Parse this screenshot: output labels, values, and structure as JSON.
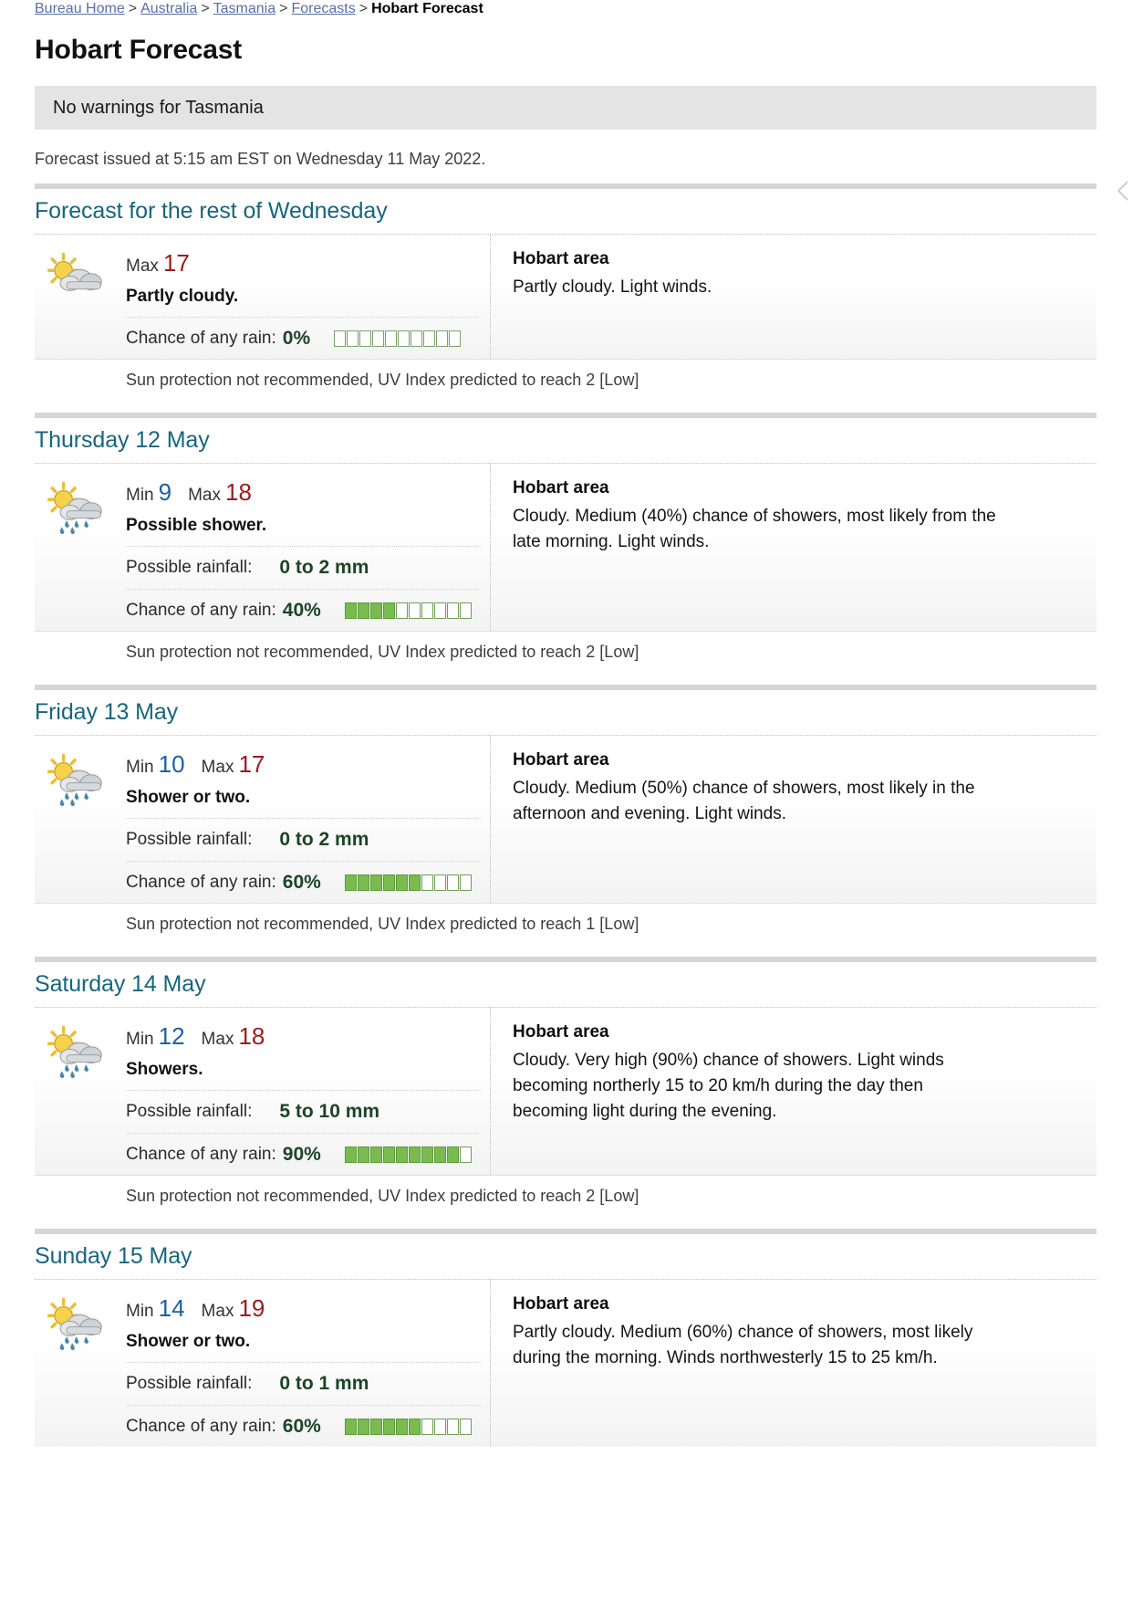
{
  "breadcrumb": {
    "items": [
      {
        "label": "Bureau Home",
        "link": true
      },
      {
        "label": "Australia",
        "link": true
      },
      {
        "label": "Tasmania",
        "link": true
      },
      {
        "label": "Forecasts",
        "link": true
      },
      {
        "label": "Hobart Forecast",
        "link": false
      }
    ],
    "separator": ">"
  },
  "page_title": "Hobart Forecast",
  "warnings": {
    "text": "No warnings for Tasmania"
  },
  "issued": "Forecast issued at 5:15 am EST on Wednesday 11 May 2022.",
  "labels": {
    "min": "Min",
    "max": "Max",
    "rainfall": "Possible rainfall:",
    "chance": "Chance of any rain:",
    "area": "Hobart area"
  },
  "colors": {
    "heading_teal": "#17667d",
    "min_blue": "#1c5fa8",
    "max_red": "#9e1b1b",
    "rain_green": "#1d4426",
    "bar_fill": "#79bb4f",
    "warning_bg": "#e4e4e4",
    "rule_grey": "#d6d6d6"
  },
  "days": [
    {
      "heading": "Forecast for the rest of Wednesday",
      "icon": "sunny-cloud-icon",
      "min": null,
      "max": "17",
      "precis": "Partly cloudy.",
      "rainfall": null,
      "chance_pct": "0%",
      "chance_blocks_on": 0,
      "chance_blocks_total": 10,
      "area": "Hobart area",
      "area_text": "Partly cloudy. Light winds.",
      "uv": "Sun protection not recommended, UV Index predicted to reach 2 [Low]"
    },
    {
      "heading": "Thursday 12 May",
      "icon": "sun-shower-icon",
      "min": "9",
      "max": "18",
      "precis": "Possible shower.",
      "rainfall": "0 to 2 mm",
      "chance_pct": "40%",
      "chance_blocks_on": 4,
      "chance_blocks_total": 10,
      "area": "Hobart area",
      "area_text": "Cloudy. Medium (40%) chance of showers, most likely from the late morning. Light winds.",
      "uv": "Sun protection not recommended, UV Index predicted to reach 2 [Low]"
    },
    {
      "heading": "Friday 13 May",
      "icon": "sun-shower-icon",
      "min": "10",
      "max": "17",
      "precis": "Shower or two.",
      "rainfall": "0 to 2 mm",
      "chance_pct": "60%",
      "chance_blocks_on": 6,
      "chance_blocks_total": 10,
      "area": "Hobart area",
      "area_text": "Cloudy. Medium (50%) chance of showers, most likely in the afternoon and evening. Light winds.",
      "uv": "Sun protection not recommended, UV Index predicted to reach 1 [Low]"
    },
    {
      "heading": "Saturday 14 May",
      "icon": "sun-shower-icon",
      "min": "12",
      "max": "18",
      "precis": "Showers.",
      "rainfall": "5 to 10 mm",
      "chance_pct": "90%",
      "chance_blocks_on": 9,
      "chance_blocks_total": 10,
      "area": "Hobart area",
      "area_text": "Cloudy. Very high (90%) chance of showers. Light winds becoming northerly 15 to 20 km/h during the day then becoming light during the evening.",
      "uv": "Sun protection not recommended, UV Index predicted to reach 2 [Low]"
    },
    {
      "heading": "Sunday 15 May",
      "icon": "sun-shower-icon",
      "min": "14",
      "max": "19",
      "precis": "Shower or two.",
      "rainfall": "0 to 1 mm",
      "chance_pct": "60%",
      "chance_blocks_on": 6,
      "chance_blocks_total": 10,
      "area": "Hobart area",
      "area_text": "Partly cloudy. Medium (60%) chance of showers, most likely during the morning. Winds northwesterly 15 to 25 km/h.",
      "uv": null
    }
  ]
}
